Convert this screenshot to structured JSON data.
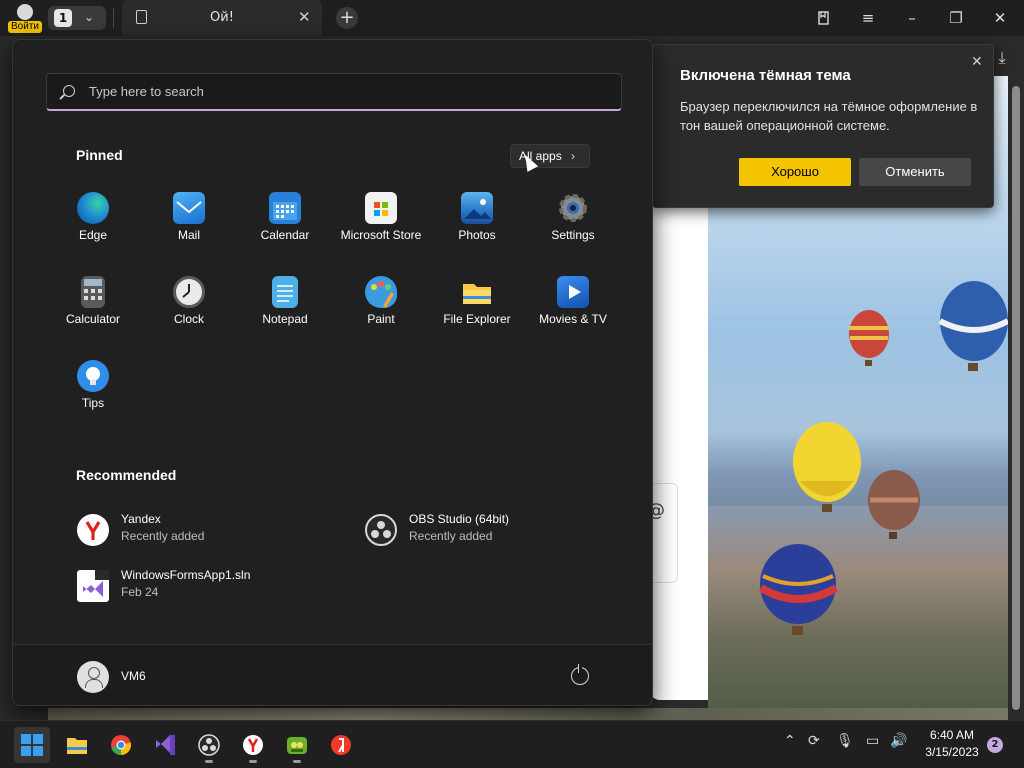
{
  "browser": {
    "login_label": "Войти",
    "tab_count": "1",
    "tab_title": "Ой!",
    "new_tab_symbol": "+",
    "close_symbol": "✕"
  },
  "notice": {
    "title": "Включена тёмная тема",
    "body": "Браузер переключился на тёмное оформление в тон вашей операционной системе.",
    "ok_label": "Хорошо",
    "cancel_label": "Отменить",
    "accent": "#f5c400"
  },
  "start_menu": {
    "search_placeholder": "Type here to search",
    "pinned_title": "Pinned",
    "all_apps_label": "All apps",
    "pinned": [
      {
        "label": "Edge",
        "icon": "edge-icon"
      },
      {
        "label": "Mail",
        "icon": "mail-icon"
      },
      {
        "label": "Calendar",
        "icon": "calendar-icon"
      },
      {
        "label": "Microsoft Store",
        "icon": "store-icon"
      },
      {
        "label": "Photos",
        "icon": "photos-icon"
      },
      {
        "label": "Settings",
        "icon": "gear-icon"
      },
      {
        "label": "Calculator",
        "icon": "calculator-icon"
      },
      {
        "label": "Clock",
        "icon": "clock-icon"
      },
      {
        "label": "Notepad",
        "icon": "notepad-icon"
      },
      {
        "label": "Paint",
        "icon": "paint-icon"
      },
      {
        "label": "File Explorer",
        "icon": "folder-icon"
      },
      {
        "label": "Movies & TV",
        "icon": "movies-icon"
      },
      {
        "label": "Tips",
        "icon": "lightbulb-icon"
      }
    ],
    "recommended_title": "Recommended",
    "recommended": [
      {
        "name": "Yandex",
        "sub": "Recently added",
        "icon": "yandex-icon"
      },
      {
        "name": "OBS Studio (64bit)",
        "sub": "Recently added",
        "icon": "obs-icon"
      },
      {
        "name": "WindowsFormsApp1.sln",
        "sub": "Feb 24",
        "icon": "visual-studio-icon"
      }
    ],
    "user_name": "VM6"
  },
  "taskbar": {
    "apps": [
      "start-icon",
      "file-explorer-icon",
      "chrome-icon",
      "visual-studio-icon",
      "obs-icon",
      "yandex-browser-icon",
      "game-icon",
      "yandex-icon"
    ],
    "time": "6:40 AM",
    "date": "3/15/2023",
    "notification_count": "2"
  }
}
